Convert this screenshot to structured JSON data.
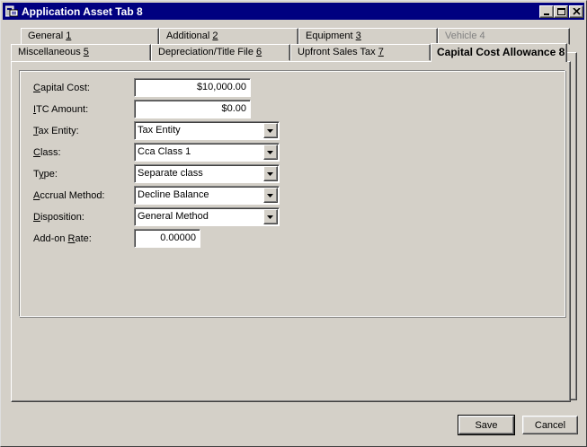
{
  "window": {
    "title": "Application Asset Tab 8",
    "controls": {
      "minimize": "minimize-icon",
      "maximize": "maximize-icon",
      "close": "close-icon"
    }
  },
  "tabs": {
    "row_back": [
      {
        "text": "General ",
        "mnemonic": "1"
      },
      {
        "text": "Additional ",
        "mnemonic": "2"
      },
      {
        "text": "Equipment ",
        "mnemonic": "3"
      },
      {
        "text": "Vehicle 4",
        "mnemonic": "",
        "disabled": true
      }
    ],
    "row_front": [
      {
        "text": "Miscellaneous ",
        "mnemonic": "5"
      },
      {
        "text": "Depreciation/Title File ",
        "mnemonic": "6"
      },
      {
        "text": "Upfront Sales Tax ",
        "mnemonic": "7"
      },
      {
        "text": "Capital Cost Allowance 8",
        "mnemonic": "",
        "active": true
      }
    ]
  },
  "form": {
    "capital_cost": {
      "label_pre": "",
      "label_mn": "C",
      "label_post": "apital Cost:",
      "value": "$10,000.00"
    },
    "itc_amount": {
      "label_pre": "",
      "label_mn": "I",
      "label_post": "TC Amount:",
      "value": "$0.00"
    },
    "tax_entity": {
      "label_pre": "",
      "label_mn": "T",
      "label_post": "ax Entity:",
      "value": "Tax Entity"
    },
    "class": {
      "label_pre": "",
      "label_mn": "C",
      "label_post": "lass:",
      "value": "Cca Class 1"
    },
    "type": {
      "label_pre": "T",
      "label_mn": "y",
      "label_post": "pe:",
      "value": "Separate class"
    },
    "accrual_method": {
      "label_pre": "",
      "label_mn": "A",
      "label_post": "ccrual Method:",
      "value": "Decline Balance"
    },
    "disposition": {
      "label_pre": "",
      "label_mn": "D",
      "label_post": "isposition:",
      "value": "General Method"
    },
    "addon_rate": {
      "label_pre": "Add-on ",
      "label_mn": "R",
      "label_post": "ate:",
      "value": "0.00000"
    }
  },
  "buttons": {
    "save": "Save",
    "cancel": "Cancel"
  }
}
